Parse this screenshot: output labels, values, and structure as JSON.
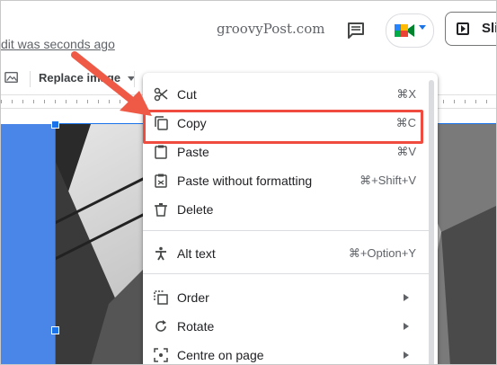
{
  "header": {
    "last_edit": "dit was seconds ago",
    "watermark": "groovyPost.com",
    "slideshow_label": "Slic"
  },
  "toolbar": {
    "replace_image_label": "Replace image"
  },
  "context_menu": {
    "items": [
      {
        "label": "Cut",
        "shortcut": "⌘X",
        "icon": "scissors-icon"
      },
      {
        "label": "Copy",
        "shortcut": "⌘C",
        "icon": "copy-icon"
      },
      {
        "label": "Paste",
        "shortcut": "⌘V",
        "icon": "clipboard-icon"
      },
      {
        "label": "Paste without formatting",
        "shortcut": "⌘+Shift+V",
        "icon": "clipboard-format-icon"
      },
      {
        "label": "Delete",
        "shortcut": "",
        "icon": "trash-icon"
      },
      {
        "label": "Alt text",
        "shortcut": "⌘+Option+Y",
        "icon": "accessibility-icon"
      },
      {
        "label": "Order",
        "shortcut": "",
        "icon": "order-icon",
        "submenu": true
      },
      {
        "label": "Rotate",
        "shortcut": "",
        "icon": "rotate-icon",
        "submenu": true
      },
      {
        "label": "Centre on page",
        "shortcut": "",
        "icon": "center-icon",
        "submenu": true
      }
    ]
  },
  "colors": {
    "highlight": "#ef4b3f",
    "selection": "#1a73e8",
    "slide_background": "#4a86e8"
  }
}
